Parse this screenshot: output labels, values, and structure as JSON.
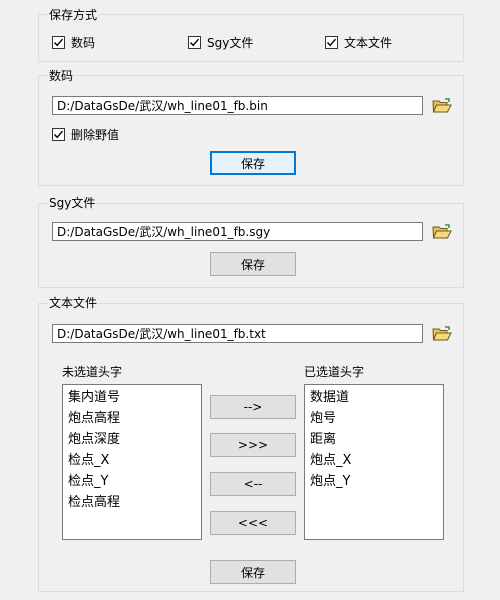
{
  "save_mode": {
    "title": "保存方式",
    "options": [
      {
        "label": "数码",
        "checked": true
      },
      {
        "label": "Sgy文件",
        "checked": true
      },
      {
        "label": "文本文件",
        "checked": true
      }
    ]
  },
  "digital": {
    "title": "数码",
    "path": "D:/DataGsDe/武汉/wh_line01_fb.bin",
    "remove_outliers_label": "删除野值",
    "remove_outliers_checked": true,
    "save_label": "保存"
  },
  "sgy": {
    "title": "Sgy文件",
    "path": "D:/DataGsDe/武汉/wh_line01_fb.sgy",
    "save_label": "保存"
  },
  "text_file": {
    "title": "文本文件",
    "path": "D:/DataGsDe/武汉/wh_line01_fb.txt",
    "unselected_label": "未选道头字",
    "selected_label": "已选道头字",
    "unselected": [
      "集内道号",
      "炮点高程",
      "炮点深度",
      "检点_X",
      "检点_Y",
      "检点高程"
    ],
    "selected": [
      "数据道",
      "炮号",
      "距离",
      "炮点_X",
      "炮点_Y"
    ],
    "move_right_label": "-->",
    "move_all_right_label": ">>>",
    "move_left_label": "<--",
    "move_all_left_label": "<<<",
    "save_label": "保存"
  },
  "icons": {
    "folder": "folder-open-icon",
    "check": "checkmark-icon"
  },
  "colors": {
    "focus_border": "#0078d7",
    "background": "#f0f0f0"
  }
}
